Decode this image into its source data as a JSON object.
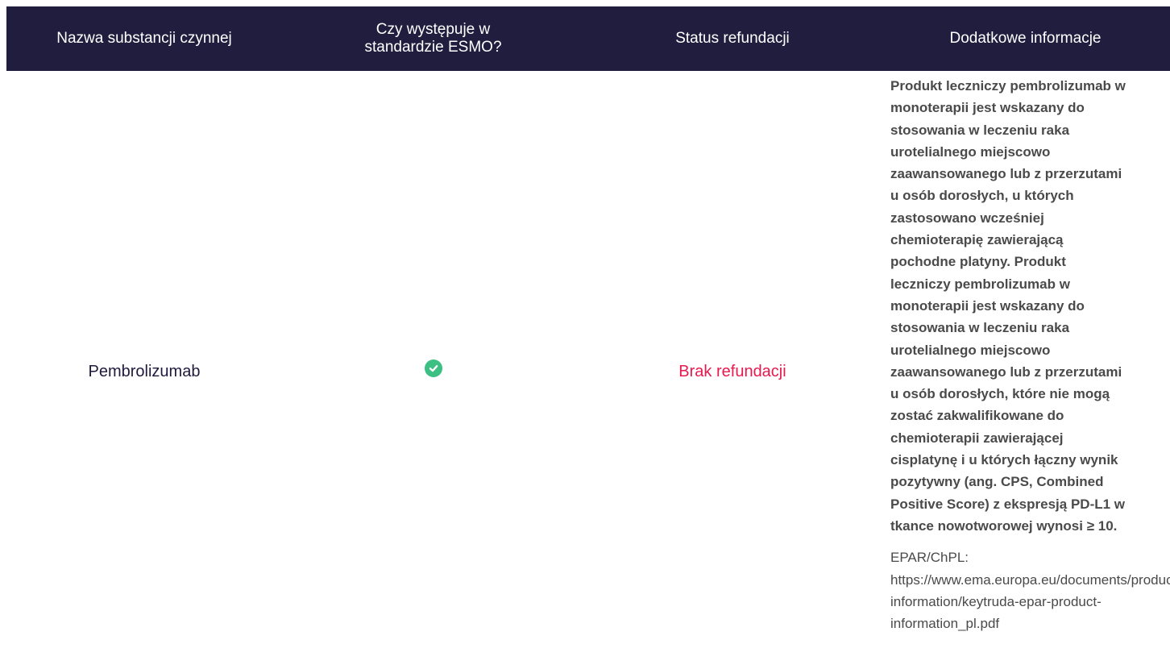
{
  "table": {
    "headers": [
      "Nazwa substancji czynnej",
      "Czy występuje w\nstandardzie ESMO?",
      "Status refundacji",
      "Dodatkowe informacje"
    ],
    "row": {
      "name": "Pembrolizumab",
      "esmo_icon": "check-circle-icon",
      "esmo_value": "Tak",
      "status": "Brak refundacji",
      "info_text": "Produkt leczniczy pembrolizumab w\nmonoterapii jest wskazany do\nstosowania w leczeniu raka\nurotelialnego miejscowo\nzaawansowanego lub z przerzutami\nu osób dorosłych, u których\nzastosowano wcześniej\nchemioterapię zawierającą\npochodne platyny. Produkt\nleczniczy pembrolizumab w\nmonoterapii jest wskazany do\nstosowania w leczeniu raka\nurotelialnego miejscowo\nzaawansowanego lub z przerzutami\nu osób dorosłych, które nie mogą\nzostać zakwalifikowane do\nchemioterapii zawierającej\ncisplatynę i u których łączny wynik\npozytywny (ang. CPS, Combined\nPositive Score) z ekspresją PD-L1 w\ntkance nowotworowej wynosi ≥ 10.",
      "epar_text": "EPAR/ChPL:\nhttps://www.ema.europa.eu/documents/product-\ninformation/keytruda-epar-product-\ninformation_pl.pdf"
    }
  },
  "colors": {
    "header_bg": "#211d3f",
    "status_red": "#e8194f",
    "check_green": "#3bbf82"
  }
}
